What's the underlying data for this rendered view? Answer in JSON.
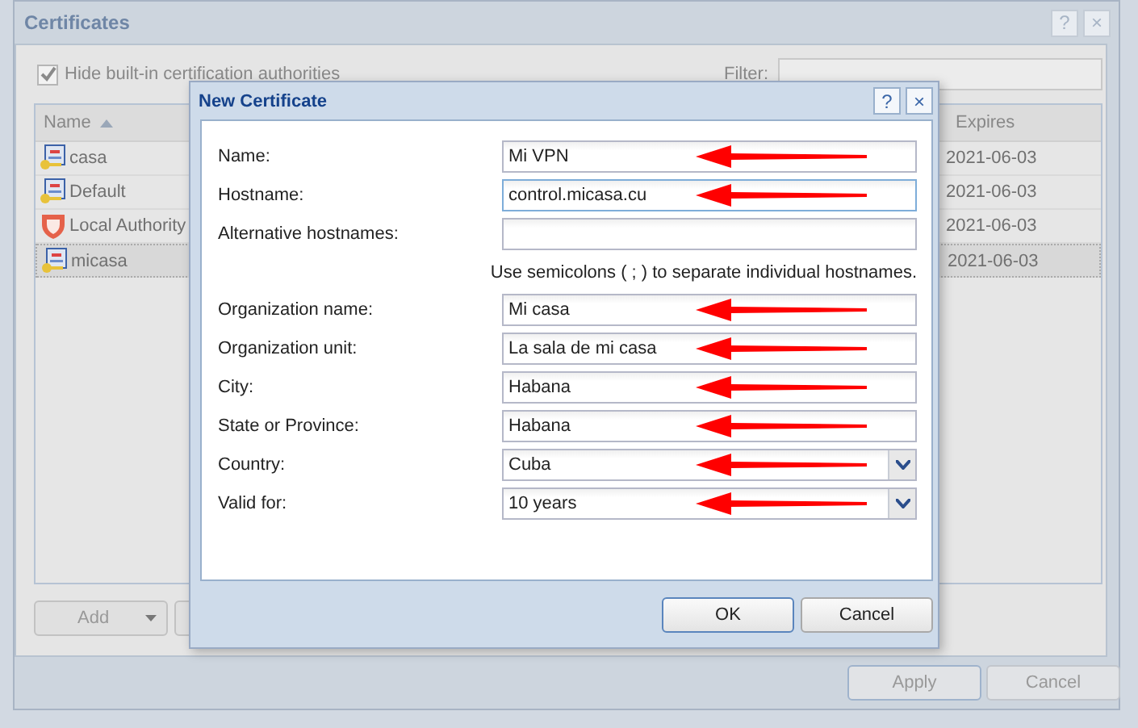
{
  "window": {
    "title": "Certificates",
    "help": "?",
    "close": "×"
  },
  "hide_builtin": {
    "label": "Hide built-in certification authorities",
    "checked": true
  },
  "filter": {
    "label": "Filter:"
  },
  "table": {
    "columns": [
      {
        "label": "Name",
        "sorted": true
      },
      {
        "label": "Expires",
        "sorted": false
      }
    ],
    "rows": [
      {
        "kind": "certificate",
        "name": "casa",
        "expires": "2021-06-03",
        "selected": false
      },
      {
        "kind": "certificate",
        "name": "Default",
        "expires": "2021-06-03",
        "selected": false
      },
      {
        "kind": "authority",
        "name": "Local Authority",
        "expires": "2021-06-03",
        "selected": false
      },
      {
        "kind": "certificate",
        "name": "micasa",
        "expires": "2021-06-03",
        "selected": true
      }
    ]
  },
  "toolbar": [
    {
      "label": "Add",
      "dropdown": true
    }
  ],
  "buttons": [
    {
      "label": "Apply",
      "focused": true
    },
    {
      "label": "Cancel",
      "focused": false
    }
  ],
  "dialog": {
    "title": "New Certificate",
    "help": "?",
    "close": "×",
    "fields": [
      {
        "kind": "text",
        "label": "Name:",
        "value": "Mi VPN",
        "focused": false,
        "arrow": true
      },
      {
        "kind": "text",
        "label": "Hostname:",
        "value": "control.micasa.cu",
        "focused": true,
        "arrow": true
      },
      {
        "kind": "text",
        "label": "Alternative hostnames:",
        "focused": false,
        "arrow": false
      },
      {
        "kind": "hint",
        "text": "Use semicolons ( ; ) to separate individual hostnames."
      },
      {
        "kind": "text",
        "label": "Organization name:",
        "value": "Mi casa",
        "focused": false,
        "arrow": true
      },
      {
        "kind": "text",
        "label": "Organization unit:",
        "value": "La sala de mi casa",
        "focused": false,
        "arrow": true
      },
      {
        "kind": "text",
        "label": "City:",
        "value": "Habana",
        "focused": false,
        "arrow": true
      },
      {
        "kind": "text",
        "label": "State or Province:",
        "value": "Habana",
        "focused": false,
        "arrow": true
      },
      {
        "kind": "combo",
        "label": "Country:",
        "value": "Cuba",
        "focused": false,
        "arrow": true
      },
      {
        "kind": "combo",
        "label": "Valid for:",
        "value": "10 years",
        "focused": false,
        "arrow": true
      }
    ],
    "buttons": [
      {
        "label": "OK",
        "focused": true
      },
      {
        "label": "Cancel",
        "focused": false
      }
    ]
  }
}
